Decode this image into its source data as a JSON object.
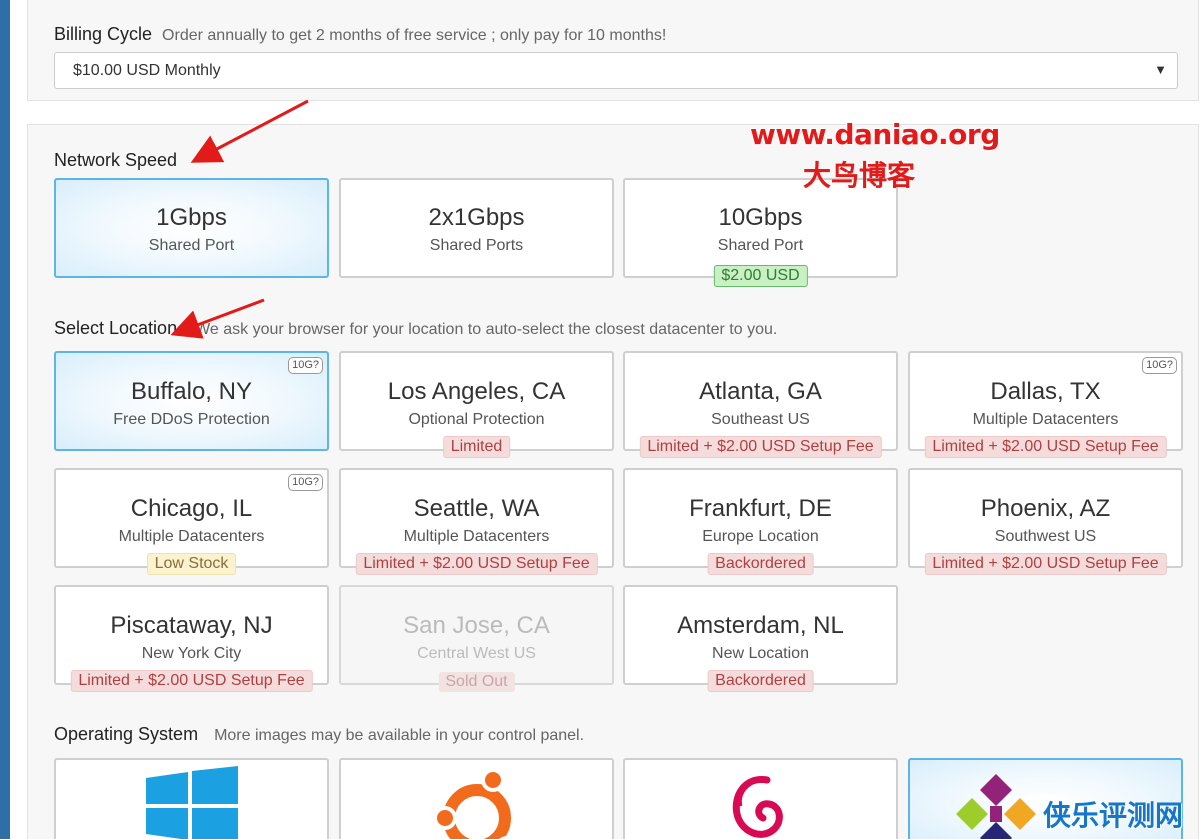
{
  "billing": {
    "title": "Billing Cycle",
    "hint": "Order annually to get 2 months of free service ; only pay for 10 months!",
    "selected": "$10.00 USD Monthly"
  },
  "network": {
    "title": "Network Speed",
    "options": [
      {
        "name": "1Gbps",
        "desc": "Shared Port"
      },
      {
        "name": "2x1Gbps",
        "desc": "Shared Ports"
      },
      {
        "name": "10Gbps",
        "desc": "Shared Port",
        "price": "$2.00 USD"
      }
    ]
  },
  "location": {
    "title": "Select Location",
    "hint": "We ask your browser for your location to auto-select the closest datacenter to you.",
    "items": [
      {
        "name": "Buffalo, NY",
        "desc": "Free DDoS Protection",
        "tag": "10G?"
      },
      {
        "name": "Los Angeles, CA",
        "desc": "Optional Protection",
        "badge": "Limited"
      },
      {
        "name": "Atlanta, GA",
        "desc": "Southeast US",
        "badge": "Limited + $2.00 USD Setup Fee"
      },
      {
        "name": "Dallas, TX",
        "desc": "Multiple Datacenters",
        "badge": "Limited + $2.00 USD Setup Fee",
        "tag": "10G?"
      },
      {
        "name": "Chicago, IL",
        "desc": "Multiple Datacenters",
        "badge": "Low Stock",
        "tag": "10G?"
      },
      {
        "name": "Seattle, WA",
        "desc": "Multiple Datacenters",
        "badge": "Limited + $2.00 USD Setup Fee"
      },
      {
        "name": "Frankfurt, DE",
        "desc": "Europe Location",
        "badge": "Backordered"
      },
      {
        "name": "Phoenix, AZ",
        "desc": "Southwest US",
        "badge": "Limited + $2.00 USD Setup Fee"
      },
      {
        "name": "Piscataway, NJ",
        "desc": "New York City",
        "badge": "Limited + $2.00 USD Setup Fee"
      },
      {
        "name": "San Jose, CA",
        "desc": "Central West US",
        "badge": "Sold Out"
      },
      {
        "name": "Amsterdam, NL",
        "desc": "New Location",
        "badge": "Backordered"
      }
    ]
  },
  "os": {
    "title": "Operating System",
    "hint": "More images may be available in your control panel."
  },
  "watermark": {
    "site": "www.daniao.org",
    "blog": "大鸟博客",
    "corner": "侠乐评测网"
  },
  "colors": {
    "selected_border": "#5cb6e5",
    "badge_red": "#b04040",
    "badge_green": "#2e7d32",
    "watermark_red": "#e21a1a",
    "sidebar_blue": "#2f6fa8"
  }
}
